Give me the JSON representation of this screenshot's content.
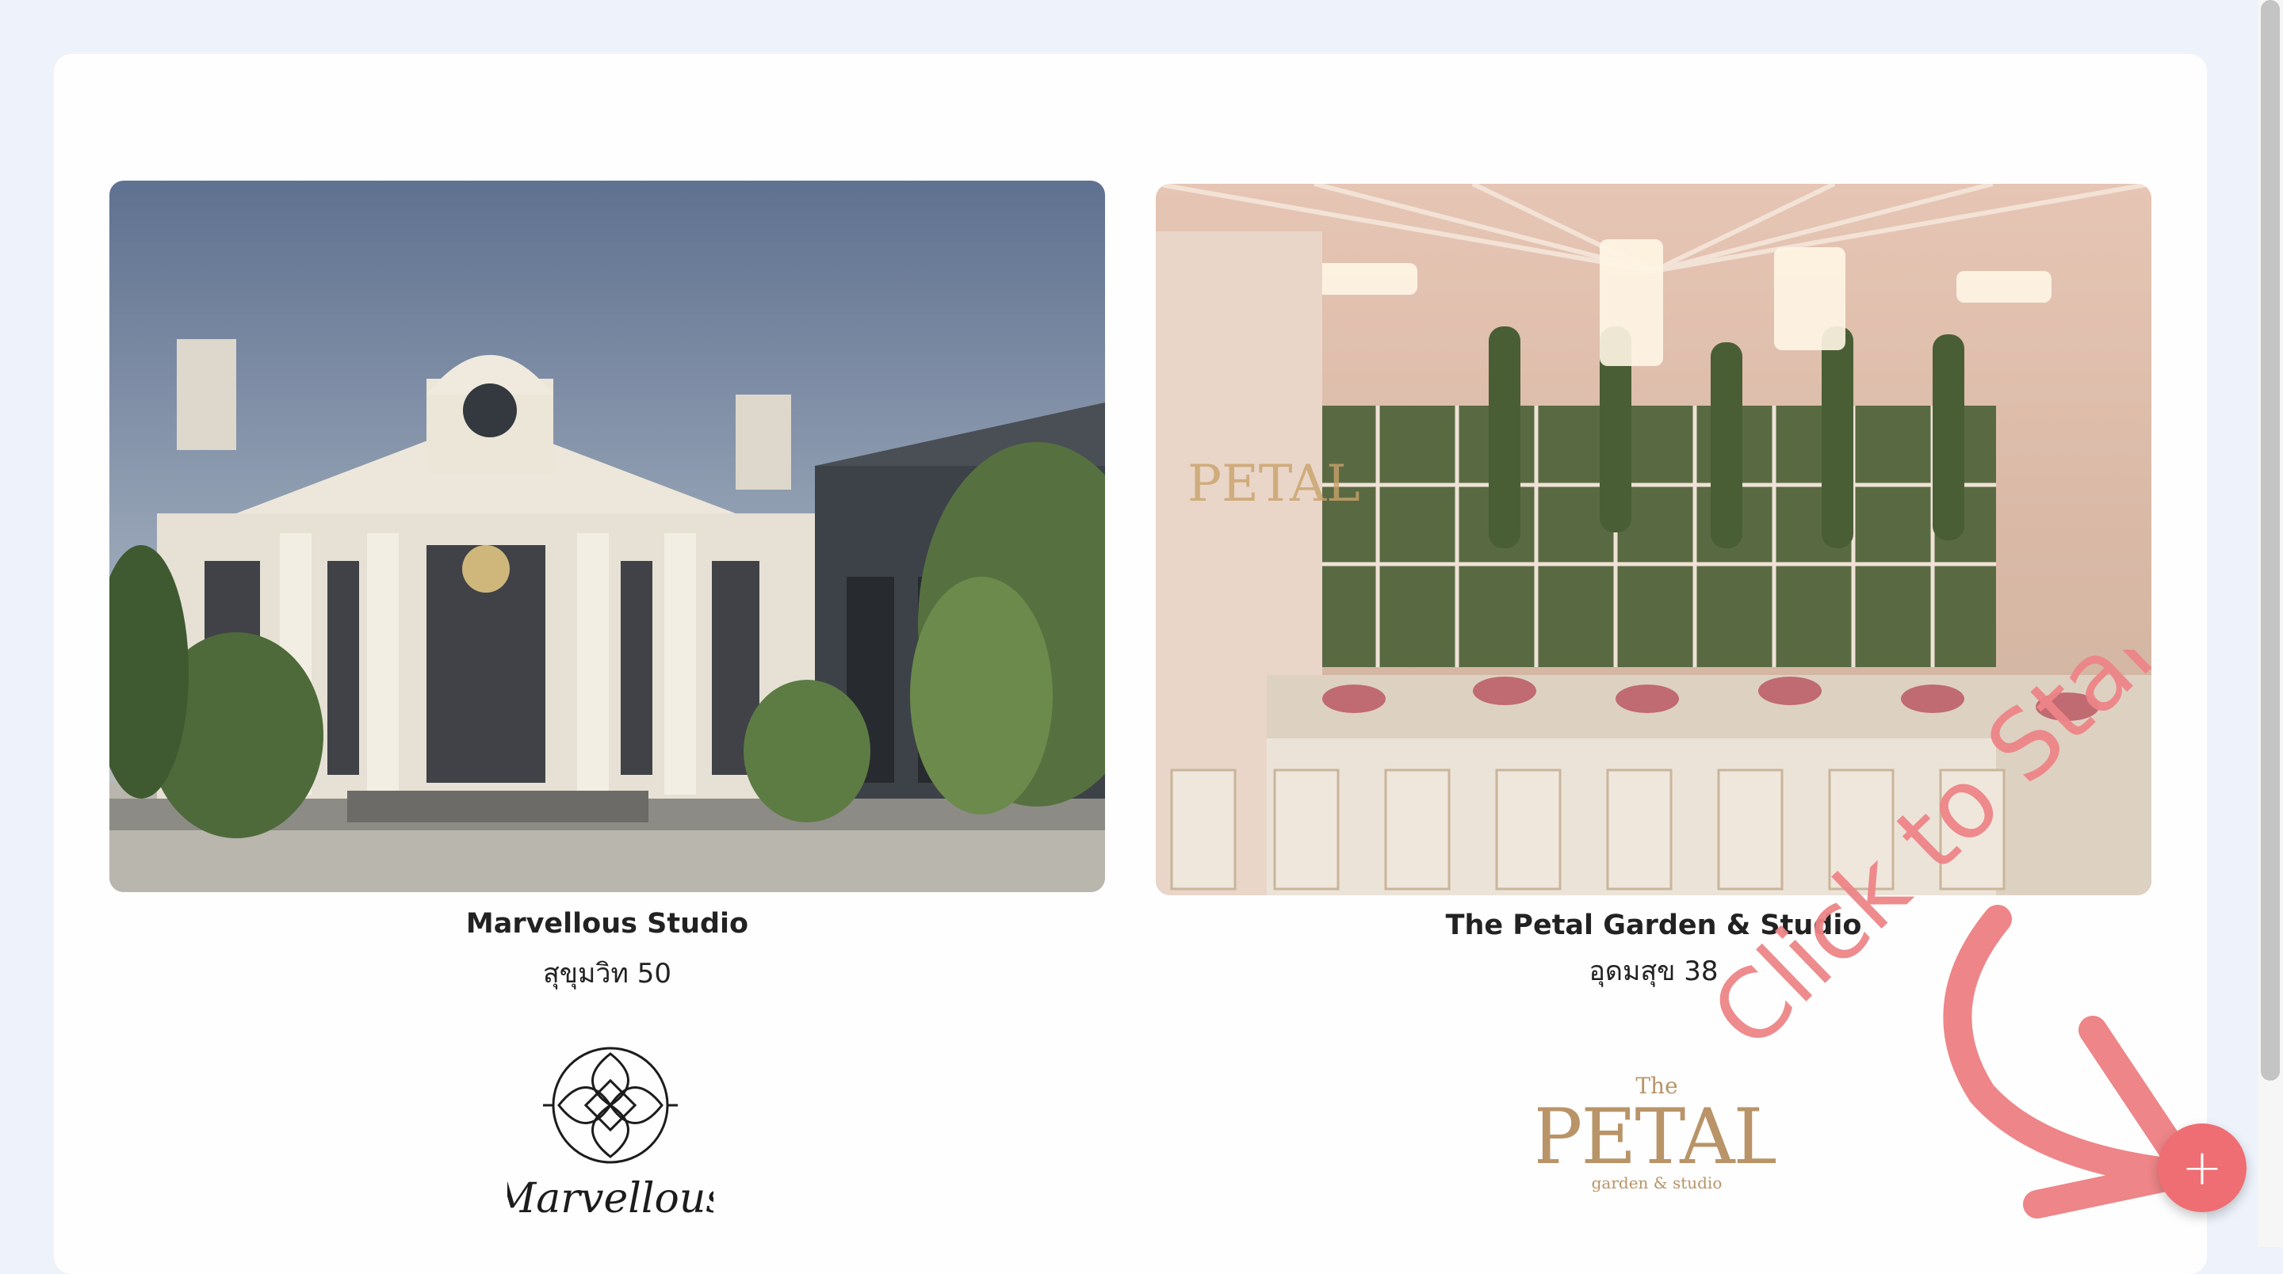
{
  "venues": [
    {
      "name": "Marvellous Studio",
      "location": "สุขุมวิท 50",
      "logo_text": "Marvellous"
    },
    {
      "name": "The Petal Garden & Studio",
      "location": "อุดมสุข 38",
      "logo_top": "The",
      "logo_main": "PETAL",
      "logo_sub": "garden & studio"
    }
  ],
  "overlay": {
    "cta_text": "Click to Start"
  },
  "fab": {
    "icon": "plus-icon",
    "label": "+"
  },
  "colors": {
    "accent": "#ee6e73",
    "background": "#edf2fb",
    "logo_gold": "#b89468"
  }
}
